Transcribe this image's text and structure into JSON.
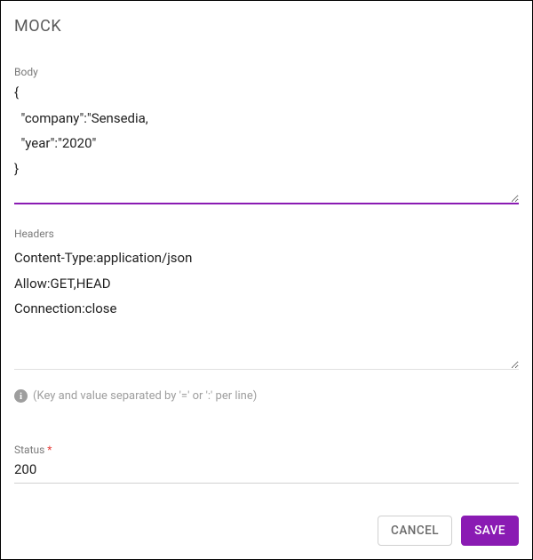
{
  "dialog": {
    "title": "MOCK"
  },
  "body": {
    "label": "Body",
    "value": "{\n  \"company\":\"Sensedia,\n  \"year\":\"2020\"\n}"
  },
  "headers": {
    "label": "Headers",
    "value": "Content-Type:application/json\nAllow:GET,HEAD\nConnection:close",
    "helper": "(Key and value separated by '=' or ':' per line)"
  },
  "status": {
    "label": "Status",
    "required_mark": "*",
    "value": "200"
  },
  "actions": {
    "cancel": "CANCEL",
    "save": "SAVE"
  }
}
